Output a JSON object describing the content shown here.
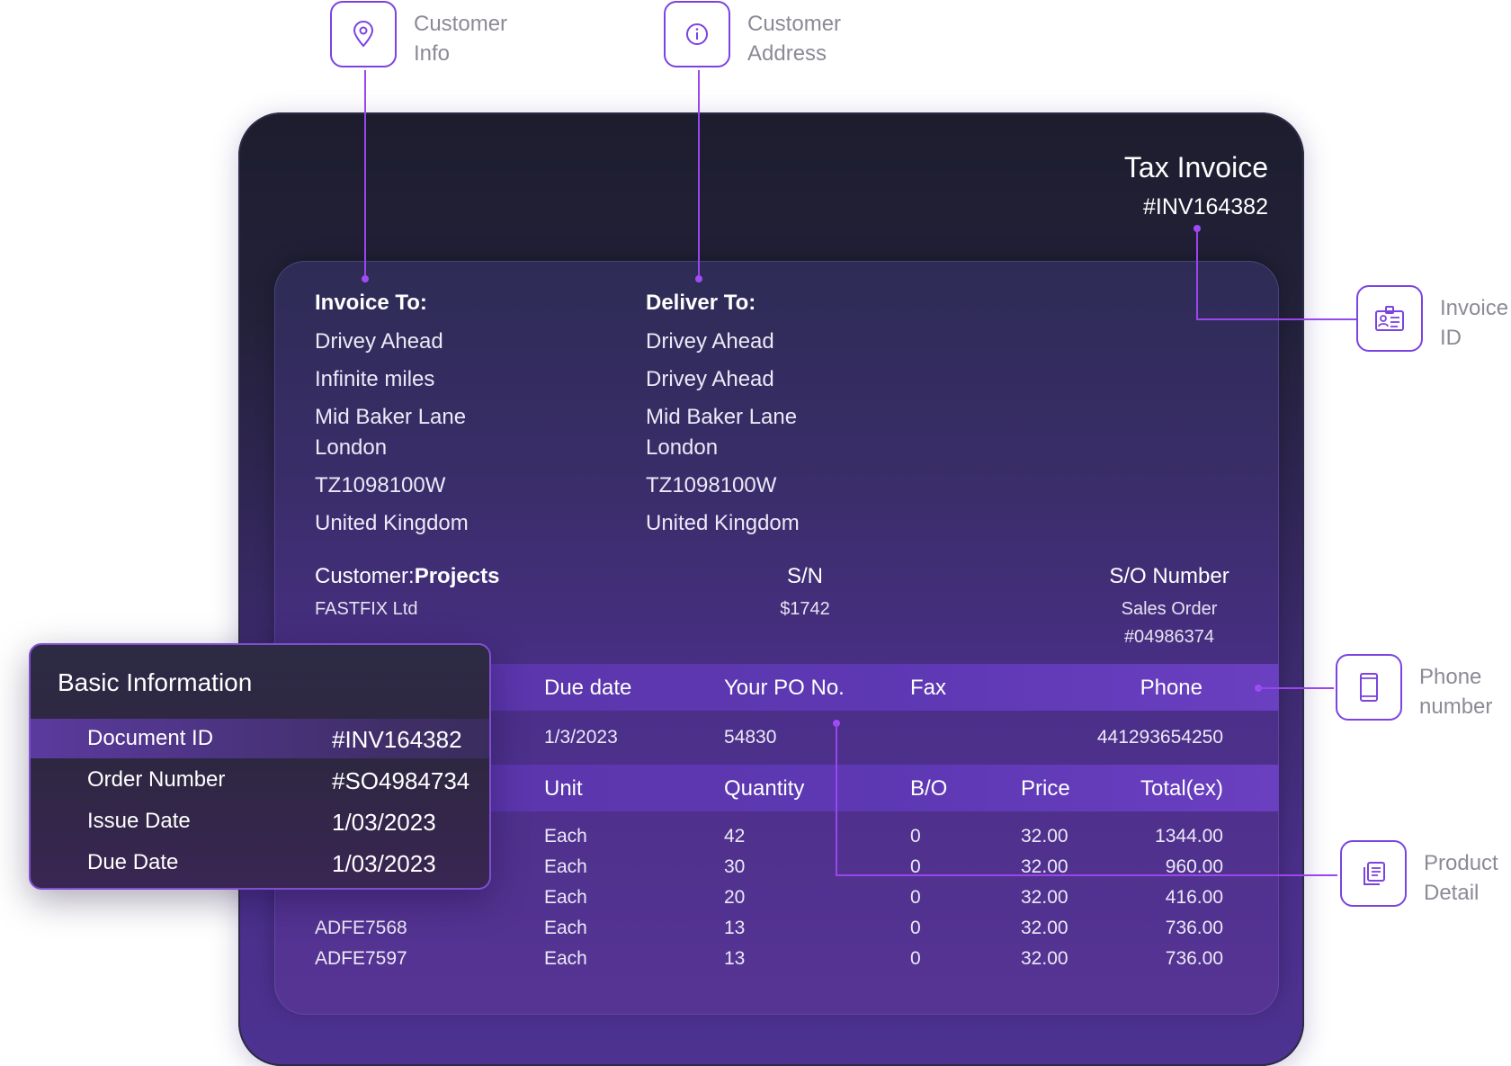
{
  "invoice": {
    "title": "Tax Invoice",
    "number": "#INV164382"
  },
  "invoice_to": {
    "heading": "Invoice To:",
    "lines": [
      "Drivey Ahead",
      "Infinite miles",
      "Mid Baker Lane",
      "London",
      "TZ1098100W",
      "United Kingdom"
    ]
  },
  "deliver_to": {
    "heading": "Deliver To:",
    "lines": [
      "Drivey Ahead",
      "Drivey Ahead",
      "Mid Baker Lane",
      "London",
      "TZ1098100W",
      "United Kingdom"
    ]
  },
  "customer": {
    "label": "Customer:",
    "label_bold": "Projects",
    "value": "FASTFIX Ltd"
  },
  "sn": {
    "label": "S/N",
    "value": "$1742"
  },
  "so": {
    "label": "S/O Number",
    "value_line1": "Sales Order",
    "value_line2": "#04986374"
  },
  "order_band": {
    "headers": [
      "Due date",
      "Your PO No.",
      "Fax",
      "Phone"
    ],
    "values": [
      "1/3/2023",
      "54830",
      "",
      "441293654250"
    ]
  },
  "items_band": {
    "headers": [
      "Unit",
      "Quantity",
      "B/O",
      "Price",
      "Total(ex)"
    ]
  },
  "items": [
    {
      "code": "",
      "unit": "Each",
      "qty": "42",
      "bo": "0",
      "price": "32.00",
      "total": "1344.00"
    },
    {
      "code": "",
      "unit": "Each",
      "qty": "30",
      "bo": "0",
      "price": "32.00",
      "total": "960.00"
    },
    {
      "code": "",
      "unit": "Each",
      "qty": "20",
      "bo": "0",
      "price": "32.00",
      "total": "416.00"
    },
    {
      "code": "ADFE7568",
      "unit": "Each",
      "qty": "13",
      "bo": "0",
      "price": "32.00",
      "total": "736.00"
    },
    {
      "code": "ADFE7597",
      "unit": "Each",
      "qty": "13",
      "bo": "0",
      "price": "32.00",
      "total": "736.00"
    }
  ],
  "basic_info": {
    "title": "Basic Information",
    "rows": [
      {
        "label": "Document ID",
        "value": "#INV164382"
      },
      {
        "label": "Order Number",
        "value": "#SO4984734"
      },
      {
        "label": "Issue Date",
        "value": "1/03/2023"
      },
      {
        "label": "Due Date",
        "value": "1/03/2023"
      }
    ]
  },
  "callouts": {
    "customer_info": {
      "line1": "Customer",
      "line2": "Info",
      "icon": "location-pin-icon"
    },
    "customer_address": {
      "line1": "Customer",
      "line2": "Address",
      "icon": "info-icon"
    },
    "invoice_id": {
      "line1": "Invoice",
      "line2": "ID",
      "icon": "id-card-icon"
    },
    "phone_number": {
      "line1": "Phone",
      "line2": "number",
      "icon": "phone-icon"
    },
    "product_detail": {
      "line1": "Product",
      "line2": "Detail",
      "icon": "document-icon"
    }
  },
  "colors": {
    "accent": "#9a45ee",
    "callout_border": "#7b43e0",
    "card_dark": "#1d1d2e",
    "band": "#5d38b3"
  }
}
